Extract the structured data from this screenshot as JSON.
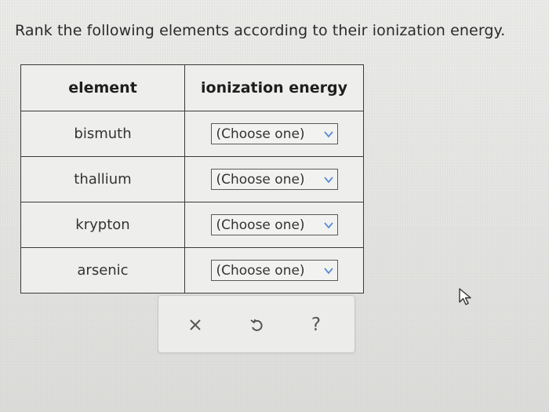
{
  "question": {
    "prompt": "Rank the following elements according to their ionization energy."
  },
  "table": {
    "headers": {
      "element": "element",
      "ionization_energy": "ionization energy"
    },
    "rows": [
      {
        "element": "bismuth",
        "selected": "(Choose one)"
      },
      {
        "element": "thallium",
        "selected": "(Choose one)"
      },
      {
        "element": "krypton",
        "selected": "(Choose one)"
      },
      {
        "element": "arsenic",
        "selected": "(Choose one)"
      }
    ]
  },
  "actions": {
    "clear_icon": "close-icon",
    "undo_icon": "undo-icon",
    "help_label": "?"
  },
  "colors": {
    "accent": "#5b8bd6",
    "text": "#2b2b2b",
    "border": "#3a3a3a",
    "icon": "#555555"
  }
}
